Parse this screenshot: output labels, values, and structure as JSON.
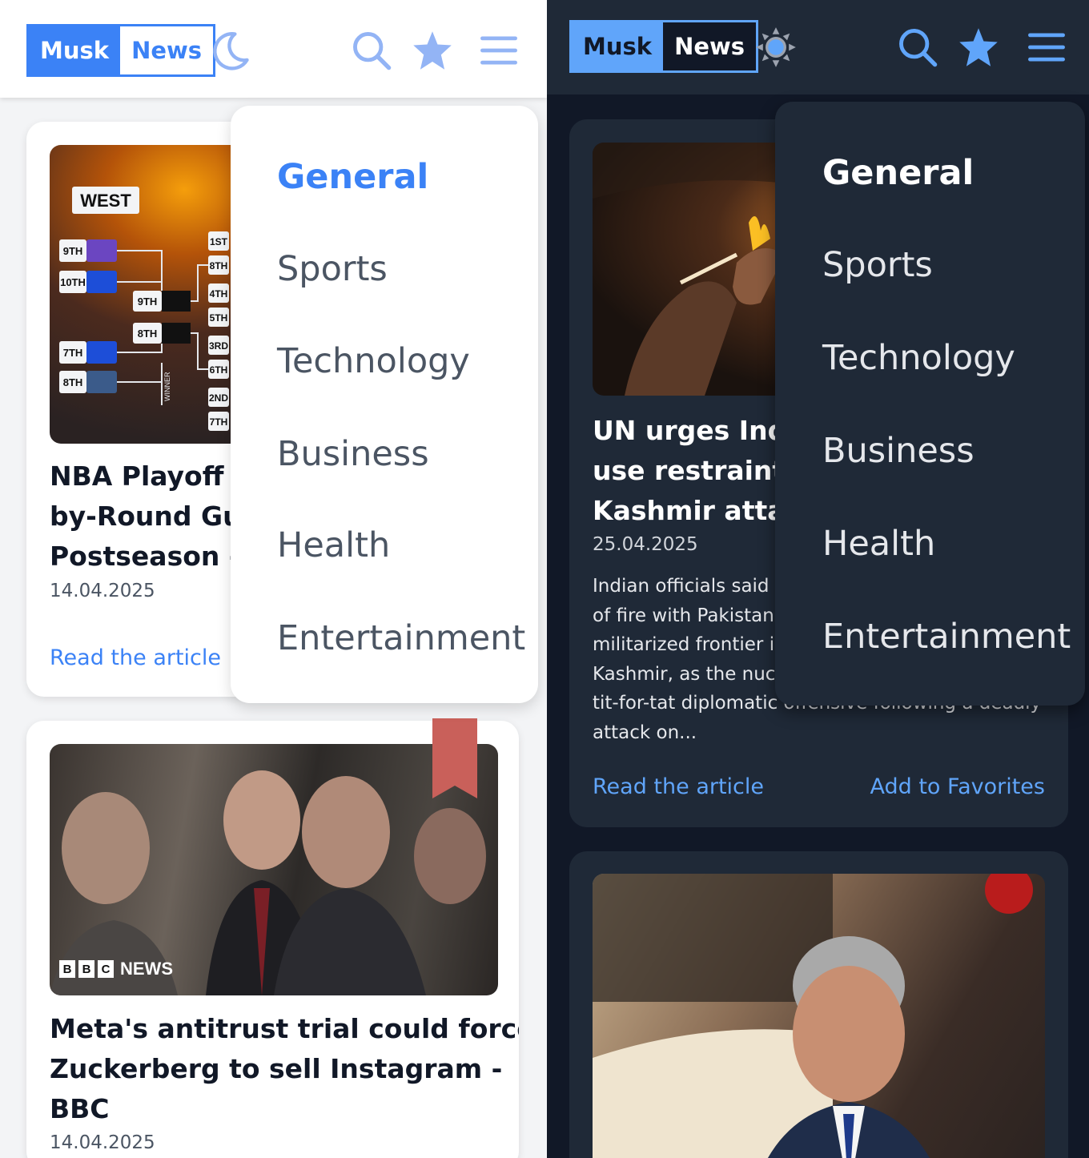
{
  "light": {
    "logo": {
      "part1": "Musk",
      "part2": "News"
    },
    "header_icons": [
      "moon-icon",
      "search-icon",
      "star-icon",
      "menu-icon"
    ],
    "menu": {
      "active": "General",
      "items": [
        {
          "label": "General"
        },
        {
          "label": "Sports"
        },
        {
          "label": "Technology"
        },
        {
          "label": "Business"
        },
        {
          "label": "Health"
        },
        {
          "label": "Entertainment"
        }
      ]
    },
    "articles": [
      {
        "title_lines": [
          "NBA Playoff B",
          "by-Round Gui",
          "Postseason - E"
        ],
        "date": "14.04.2025",
        "read_label": "Read the article",
        "image": {
          "bracket_label": "WEST",
          "seeds_left": [
            "9TH",
            "10TH",
            "7TH",
            "8TH"
          ],
          "seeds_mid": [
            "9TH",
            "8TH"
          ],
          "seeds_right": [
            "1ST",
            "8TH",
            "4TH",
            "5TH",
            "3RD",
            "6TH",
            "2ND",
            "7TH"
          ],
          "winner_label": "WINNER"
        }
      },
      {
        "title_lines": [
          "Meta's antitrust trial could force",
          "Zuckerberg to sell Instagram -",
          "BBC"
        ],
        "date": "14.04.2025",
        "image": {
          "watermark": "NEWS",
          "watermark_boxes": [
            "B",
            "B",
            "C"
          ]
        },
        "bookmark_color": "#c9605a"
      }
    ]
  },
  "dark": {
    "logo": {
      "part1": "Musk",
      "part2": "News"
    },
    "header_icons": [
      "sun-icon",
      "search-icon",
      "star-icon",
      "menu-icon"
    ],
    "menu": {
      "active": "General",
      "items": [
        {
          "label": "General"
        },
        {
          "label": "Sports"
        },
        {
          "label": "Technology"
        },
        {
          "label": "Business"
        },
        {
          "label": "Health"
        },
        {
          "label": "Entertainment"
        }
      ]
    },
    "articles": [
      {
        "title_lines": [
          "UN urges Indi",
          "use restraint a",
          "Kashmir attacl"
        ],
        "date": "25.04.2025",
        "desc_lines": [
          "Indian officials said t",
          "of fire with Pakistani",
          "militarized frontier ir",
          "Kashmir, as the nucle",
          "tit-for-tat diplomatic offensive following a deadly",
          "attack on..."
        ],
        "read_label": "Read the article",
        "fav_label": "Add to Favorites"
      }
    ]
  },
  "colors": {
    "accent_light": "#3b82f6",
    "accent_dark": "#60a5fa",
    "dark_bg": "#111827",
    "dark_card": "#1f2937"
  }
}
